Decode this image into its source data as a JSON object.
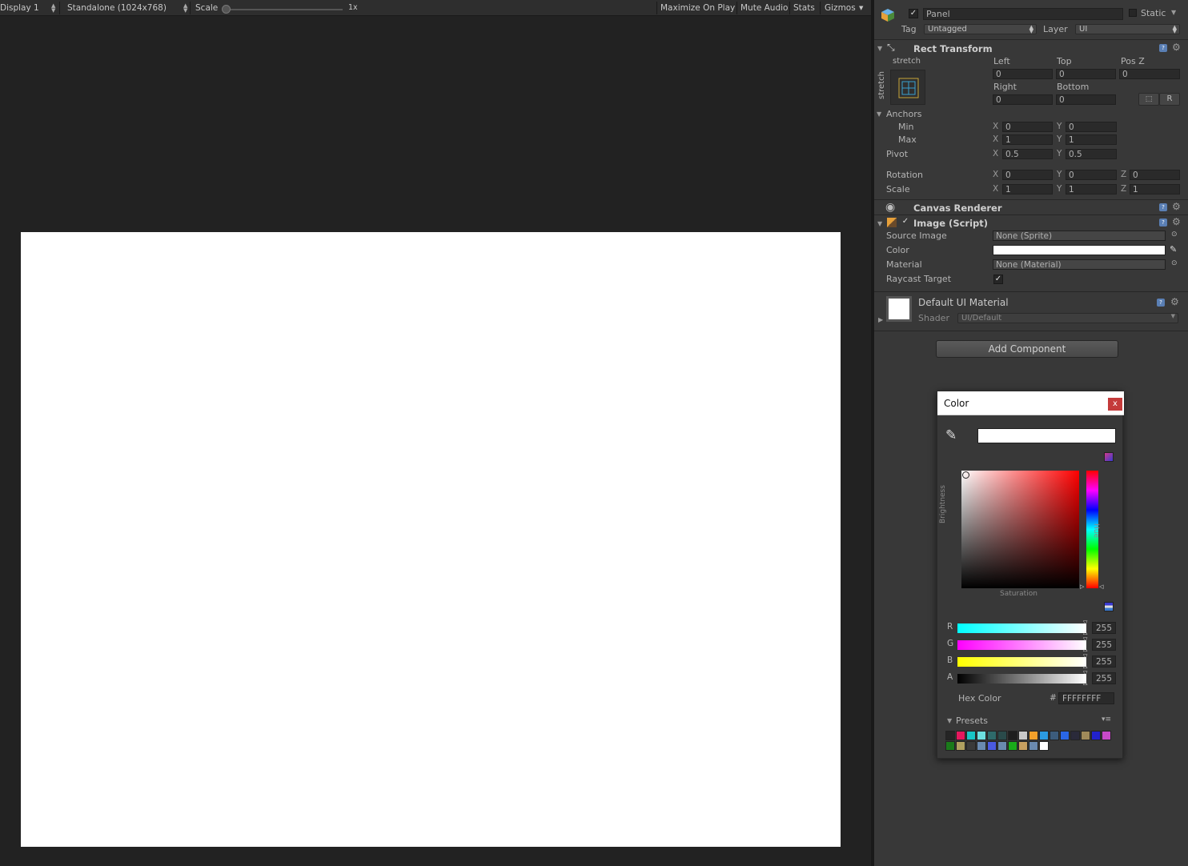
{
  "game_toolbar": {
    "display": "Display 1",
    "resolution": "Standalone (1024x768)",
    "scale_label": "Scale",
    "scale_value": 0.0,
    "scale_text": "1x",
    "maximize": "Maximize On Play",
    "mute": "Mute Audio",
    "stats": "Stats",
    "gizmos": "Gizmos"
  },
  "object": {
    "enabled": true,
    "name": "Panel",
    "static_label": "Static",
    "tag_label": "Tag",
    "tag_value": "Untagged",
    "layer_label": "Layer",
    "layer_value": "UI"
  },
  "rect_transform": {
    "title": "Rect Transform",
    "stretch_top": "stretch",
    "stretch_side": "stretch",
    "left_label": "Left",
    "left": "0",
    "top_label": "Top",
    "top": "0",
    "posz_label": "Pos Z",
    "posz": "0",
    "right_label": "Right",
    "right": "0",
    "bottom_label": "Bottom",
    "bottom": "0",
    "r_button": "R",
    "anchors_label": "Anchors",
    "min_label": "Min",
    "min_x": "0",
    "min_y": "0",
    "max_label": "Max",
    "max_x": "1",
    "max_y": "1",
    "pivot_label": "Pivot",
    "pivot_x": "0.5",
    "pivot_y": "0.5",
    "rotation_label": "Rotation",
    "rot_x": "0",
    "rot_y": "0",
    "rot_z": "0",
    "scale_label": "Scale",
    "scale_x": "1",
    "scale_y": "1",
    "scale_z": "1",
    "x": "X",
    "y": "Y",
    "z": "Z"
  },
  "canvas_renderer": {
    "title": "Canvas Renderer"
  },
  "image_script": {
    "title": "Image (Script)",
    "enabled": true,
    "source_image_label": "Source Image",
    "source_image": "None (Sprite)",
    "color_label": "Color",
    "color": "#ffffff",
    "material_label": "Material",
    "material": "None (Material)",
    "raycast_label": "Raycast Target",
    "raycast": true
  },
  "material_panel": {
    "name": "Default UI Material",
    "shader_label": "Shader",
    "shader": "UI/Default"
  },
  "add_component": "Add Component",
  "color_window": {
    "title": "Color",
    "close": "x",
    "saturation_label": "Saturation",
    "brightness_label": "Brightness",
    "hue_label": "Hue",
    "channels": [
      {
        "label": "R",
        "value": "255"
      },
      {
        "label": "G",
        "value": "255"
      },
      {
        "label": "B",
        "value": "255"
      },
      {
        "label": "A",
        "value": "255"
      }
    ],
    "hex_label": "Hex Color",
    "hex_prefix": "#",
    "hex": "FFFFFFFF",
    "presets_label": "Presets",
    "presets_row1": [
      "#252525",
      "#e5185e",
      "#18c6c6",
      "#6de0e0",
      "#2e6a6a",
      "#2a4a4a",
      "#1e1e1e",
      "#c9c9c9",
      "#f2a02a",
      "#2b9ae0",
      "#3c5c7c",
      "#2a66e6",
      "#2a2a3a",
      "#a08a5a",
      "#2222cc",
      "#c84ac8"
    ],
    "presets_row2": [
      "#1a7a1a",
      "#b0a060",
      "#3a3a3a",
      "#6a8ab0",
      "#4a5ae0",
      "#6a8ab0",
      "#1aaa1a",
      "#c8a060",
      "#6a8ab0",
      "#ffffff"
    ]
  }
}
